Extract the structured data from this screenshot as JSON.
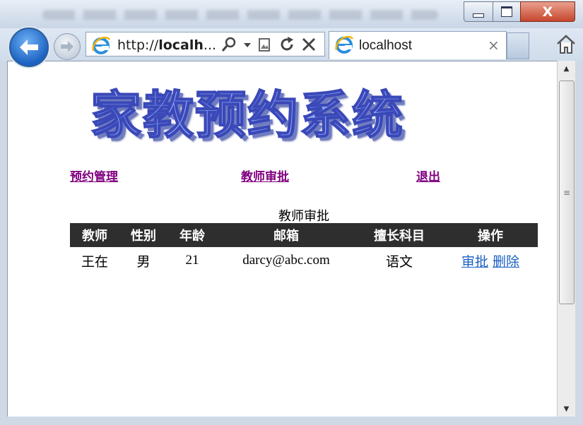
{
  "browser": {
    "address": {
      "prefix": "http://",
      "host_bold": "localh",
      "ellipsis": "..."
    },
    "tab": {
      "title": "localhost",
      "close": "×"
    },
    "window_buttons": {
      "close": "X"
    }
  },
  "page": {
    "logo_text": "家教预约系统",
    "nav": {
      "appointments": "预约管理",
      "teacher_approval": "教师审批",
      "logout": "退出"
    },
    "caption": "教师审批",
    "table": {
      "headers": [
        "教师",
        "性别",
        "年龄",
        "邮箱",
        "擅长科目",
        "操作"
      ],
      "rows": [
        {
          "teacher": "王在",
          "gender": "男",
          "age": "21",
          "email": "darcy@abc.com",
          "subject": "语文",
          "actions": {
            "approve": "审批",
            "delete": "删除"
          }
        }
      ]
    }
  },
  "colors": {
    "nav_link": "#800080",
    "header_bg": "#2e2e2e",
    "action_link": "#1a5fc4",
    "logo_fill": "#8ea6f5"
  }
}
